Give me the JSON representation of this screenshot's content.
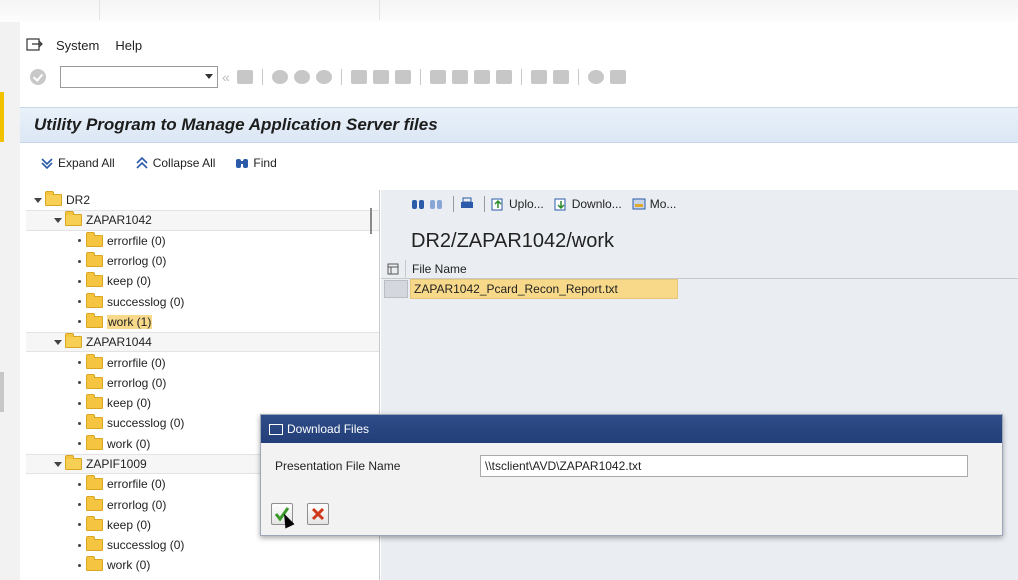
{
  "menu": {
    "system": "System",
    "help": "Help"
  },
  "title": "Utility Program to Manage Application Server files",
  "app_toolbar": {
    "expand_all": "Expand All",
    "collapse_all": "Collapse All",
    "find": "Find"
  },
  "tree": [
    {
      "label": "DR2",
      "level": 0,
      "type": "expanded-folder"
    },
    {
      "label": "ZAPAR1042",
      "level": 1,
      "type": "expanded-folder"
    },
    {
      "label": "errorfile (0)",
      "level": 2
    },
    {
      "label": "errorlog (0)",
      "level": 2
    },
    {
      "label": "keep (0)",
      "level": 2
    },
    {
      "label": "successlog (0)",
      "level": 2
    },
    {
      "label": "work (1)",
      "level": 2,
      "selected": true
    },
    {
      "label": "ZAPAR1044",
      "level": 1,
      "type": "expanded-folder"
    },
    {
      "label": "errorfile (0)",
      "level": 2
    },
    {
      "label": "errorlog (0)",
      "level": 2
    },
    {
      "label": "keep (0)",
      "level": 2
    },
    {
      "label": "successlog (0)",
      "level": 2
    },
    {
      "label": "work (0)",
      "level": 2
    },
    {
      "label": "ZAPIF1009",
      "level": 1,
      "type": "expanded-folder"
    },
    {
      "label": "errorfile (0)",
      "level": 2
    },
    {
      "label": "errorlog (0)",
      "level": 2
    },
    {
      "label": "keep (0)",
      "level": 2
    },
    {
      "label": "successlog (0)",
      "level": 2
    },
    {
      "label": "work (0)",
      "level": 2
    }
  ],
  "right_toolbar": {
    "upload": "Uplo...",
    "download": "Downlo...",
    "more": "Mo..."
  },
  "path": "DR2/ZAPAR1042/work",
  "grid": {
    "column": "File Name",
    "rows": [
      "ZAPAR1042_Pcard_Recon_Report.txt"
    ]
  },
  "dialog": {
    "title": "Download Files",
    "label": "Presentation File Name",
    "value": "\\\\tsclient\\AVD\\ZAPAR1042.txt"
  },
  "colors": {
    "title_bg": "#dbe7f4",
    "dialog_header": "#2f4d89",
    "highlight": "#f8d98a",
    "folder": "#f5c542"
  }
}
